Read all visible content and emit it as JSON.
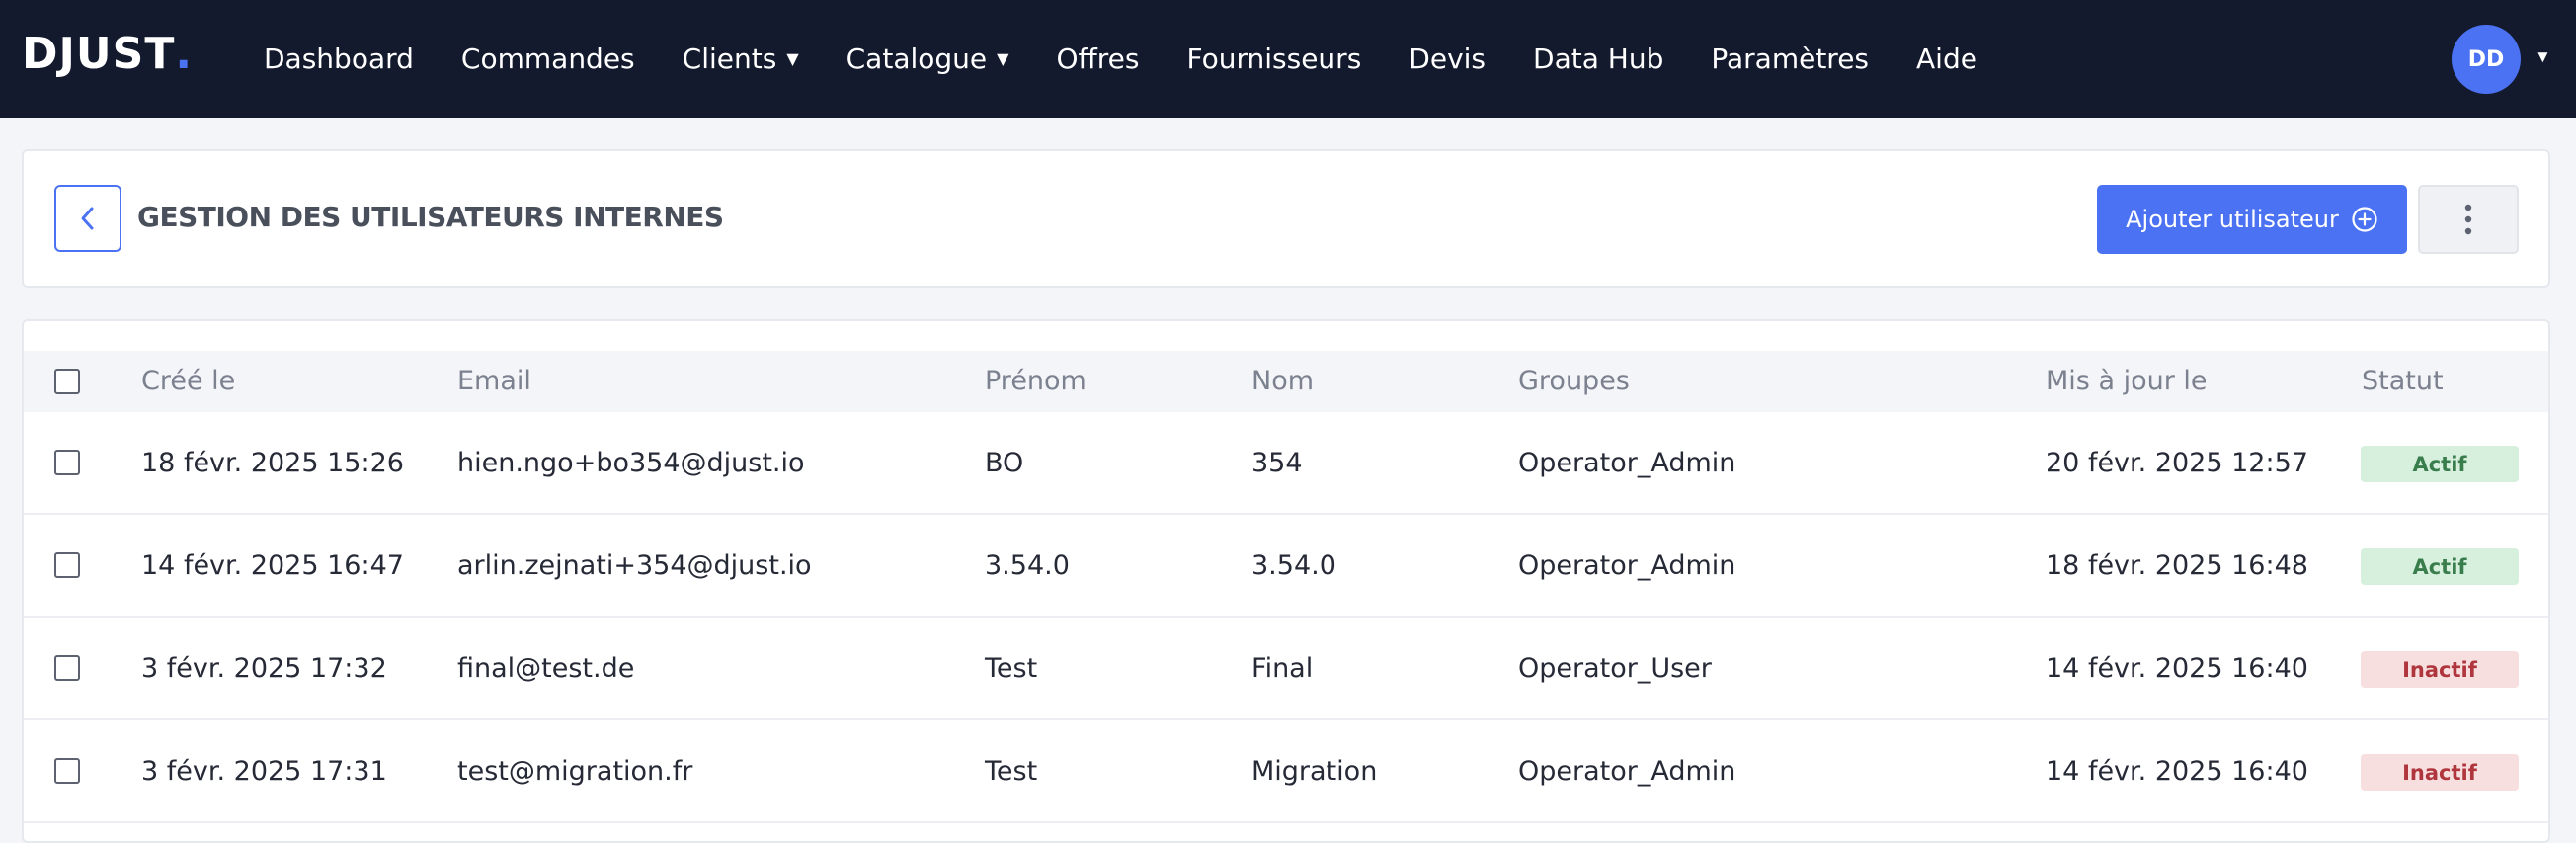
{
  "brand": {
    "logo_text": "DJUST",
    "logo_dot": ".",
    "accent_color": "#4b72f2"
  },
  "nav": {
    "items": [
      {
        "label": "Dashboard",
        "dropdown": false
      },
      {
        "label": "Commandes",
        "dropdown": false
      },
      {
        "label": "Clients",
        "dropdown": true
      },
      {
        "label": "Catalogue",
        "dropdown": true
      },
      {
        "label": "Offres",
        "dropdown": false
      },
      {
        "label": "Fournisseurs",
        "dropdown": false
      },
      {
        "label": "Devis",
        "dropdown": false
      },
      {
        "label": "Data Hub",
        "dropdown": false
      },
      {
        "label": "Paramètres",
        "dropdown": false
      },
      {
        "label": "Aide",
        "dropdown": false
      }
    ],
    "user_initials": "DD",
    "caret": "▼"
  },
  "header": {
    "title": "GESTION DES UTILISATEURS INTERNES",
    "add_button_label": "Ajouter utilisateur"
  },
  "table": {
    "columns": [
      "Créé le",
      "Email",
      "Prénom",
      "Nom",
      "Groupes",
      "Mis à jour le",
      "Statut"
    ],
    "rows": [
      {
        "created": "18 févr. 2025 15:26",
        "email": "hien.ngo+bo354@djust.io",
        "first_name": "BO",
        "last_name": "354",
        "groups": "Operator_Admin",
        "updated": "20 févr. 2025 12:57",
        "status": "Actif",
        "status_type": "active"
      },
      {
        "created": "14 févr. 2025 16:47",
        "email": "arlin.zejnati+354@djust.io",
        "first_name": "3.54.0",
        "last_name": "3.54.0",
        "groups": "Operator_Admin",
        "updated": "18 févr. 2025 16:48",
        "status": "Actif",
        "status_type": "active"
      },
      {
        "created": "3 févr. 2025 17:32",
        "email": "final@test.de",
        "first_name": "Test",
        "last_name": "Final",
        "groups": "Operator_User",
        "updated": "14 févr. 2025 16:40",
        "status": "Inactif",
        "status_type": "inactive"
      },
      {
        "created": "3 févr. 2025 17:31",
        "email": "test@migration.fr",
        "first_name": "Test",
        "last_name": "Migration",
        "groups": "Operator_Admin",
        "updated": "14 févr. 2025 16:40",
        "status": "Inactif",
        "status_type": "inactive"
      }
    ]
  },
  "colors": {
    "nav_bg": "#141a2e",
    "active_bg": "#d7f0dd",
    "active_text": "#3a7d4d",
    "inactive_bg": "#f7dfe0",
    "inactive_text": "#b0363d"
  }
}
